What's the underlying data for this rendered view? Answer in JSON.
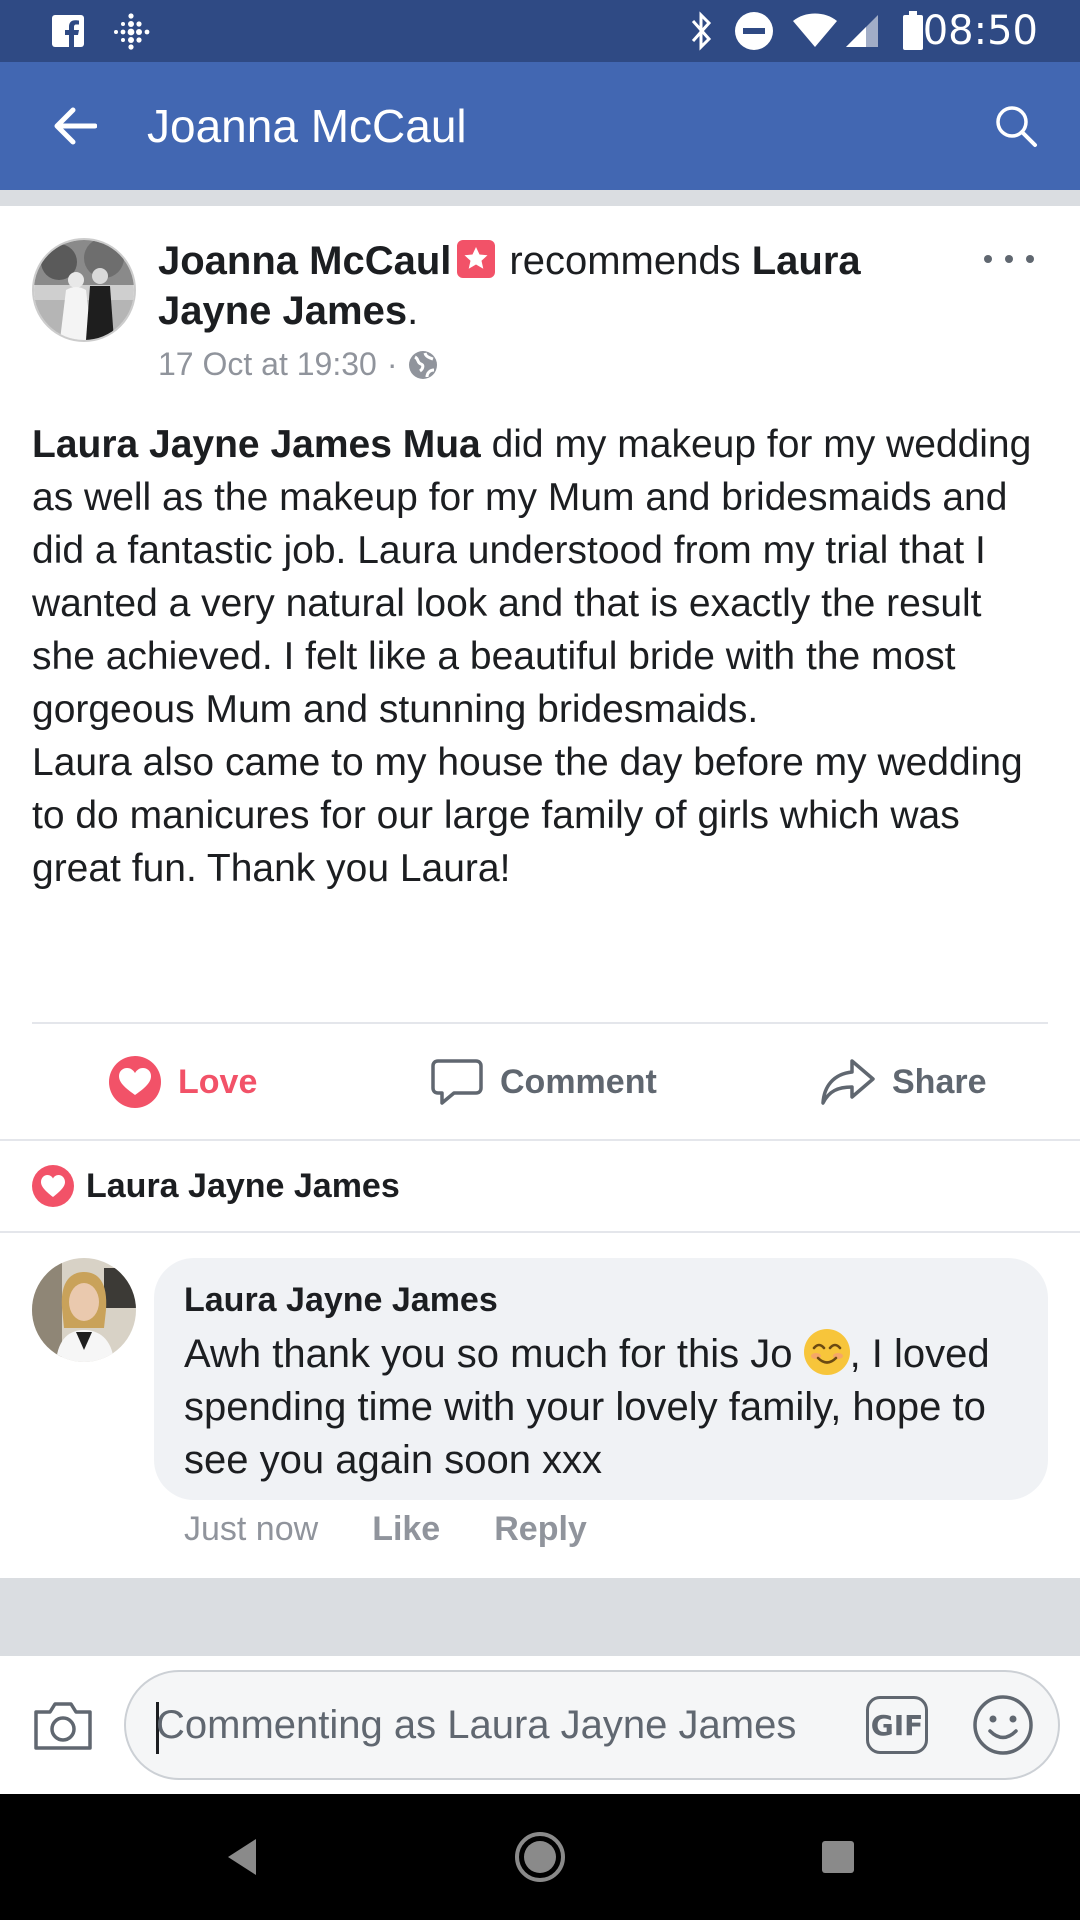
{
  "status_bar": {
    "time": "08:50",
    "icons": [
      "facebook-icon",
      "fitbit-icon",
      "bluetooth-icon",
      "do-not-disturb-icon",
      "wifi-icon",
      "signal-icon",
      "battery-icon"
    ]
  },
  "app_bar": {
    "title": "Joanna McCaul",
    "back_icon": "arrow-left-icon",
    "search_icon": "search-icon"
  },
  "post": {
    "author": "Joanna McCaul",
    "recommends_text": "recommends",
    "target": "Laura Jayne James",
    "period": ".",
    "timestamp": "17 Oct at 19:30",
    "separator": "·",
    "privacy_icon": "globe-icon",
    "body_bold": "Laura Jayne James Mua",
    "body_para1": " did my makeup for my wedding as well as the makeup for my Mum and bridesmaids and did a fantastic job. Laura understood from my trial that I wanted a very natural look and that is exactly the result she achieved. I felt like a beautiful bride with the most gorgeous Mum and stunning bridesmaids.",
    "body_para2": "Laura also came to my house the day before my wedding to do manicures for our large family of girls which was great fun. Thank you Laura!",
    "actions": {
      "love": "Love",
      "comment": "Comment",
      "share": "Share"
    }
  },
  "reactions": {
    "name": "Laura Jayne James"
  },
  "comment": {
    "author": "Laura Jayne James",
    "text_before_emoji": "Awh thank you so much for this Jo ",
    "text_after_emoji": ", I loved spending time with your lovely family, hope to see you again soon xxx",
    "time": "Just now",
    "like": "Like",
    "reply": "Reply"
  },
  "composer": {
    "placeholder": "Commenting as Laura Jayne James",
    "gif_label": "GIF"
  },
  "colors": {
    "status_bar": "#2f4a84",
    "app_bar": "#4267b2",
    "love": "#f25268",
    "muted": "#90949c"
  }
}
